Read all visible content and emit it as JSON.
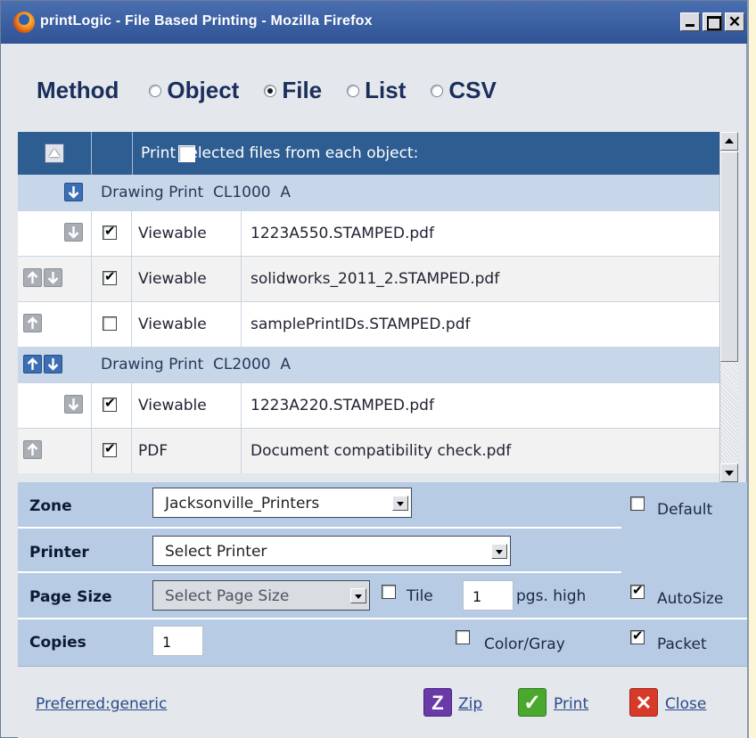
{
  "window": {
    "title": "printLogic - File Based Printing - Mozilla Firefox",
    "close_glyph": "✕"
  },
  "method": {
    "label": "Method",
    "options": [
      {
        "label": "Object",
        "selected": false
      },
      {
        "label": "File",
        "selected": true
      },
      {
        "label": "List",
        "selected": false
      },
      {
        "label": "CSV",
        "selected": false
      }
    ]
  },
  "grid": {
    "header_text": "Print selected files from each object:",
    "header_checked": false,
    "groups": [
      {
        "label": "Drawing Print  CL1000  A"
      },
      {
        "label": "Drawing Print  CL2000  A"
      }
    ],
    "files": [
      {
        "type": "Viewable",
        "name": "1223A550.STAMPED.pdf",
        "checked": true
      },
      {
        "type": "Viewable",
        "name": "solidworks_2011_2.STAMPED.pdf",
        "checked": true
      },
      {
        "type": "Viewable",
        "name": "samplePrintIDs.STAMPED.pdf",
        "checked": false
      },
      {
        "type": "Viewable",
        "name": "1223A220.STAMPED.pdf",
        "checked": true
      },
      {
        "type": "PDF",
        "name": "Document compatibility check.pdf",
        "checked": true
      }
    ]
  },
  "form": {
    "zone_label": "Zone",
    "zone_value": "Jacksonville_Printers",
    "default_label": "Default",
    "printer_label": "Printer",
    "printer_value": "Select Printer",
    "pagesize_label": "Page Size",
    "pagesize_value": "Select Page Size",
    "tile_label": "Tile",
    "tile_value": "1",
    "pgs_label": "pgs. high",
    "autosize_label": "AutoSize",
    "copies_label": "Copies",
    "copies_value": "1",
    "colorgray_label": "Color/Gray",
    "packet_label": "Packet"
  },
  "footer": {
    "preferred": "Preferred:generic",
    "zip": "Zip",
    "print": "Print",
    "close": "Close",
    "zip_glyph": "Z",
    "print_glyph": "✓",
    "close_glyph": "✕"
  },
  "colors": {
    "title_bar": "#2f5394",
    "header": "#2e5d92",
    "form_bg": "#b7cbe4",
    "zip": "#6a3aa8",
    "print": "#4ba82e",
    "close": "#d83a2a"
  }
}
